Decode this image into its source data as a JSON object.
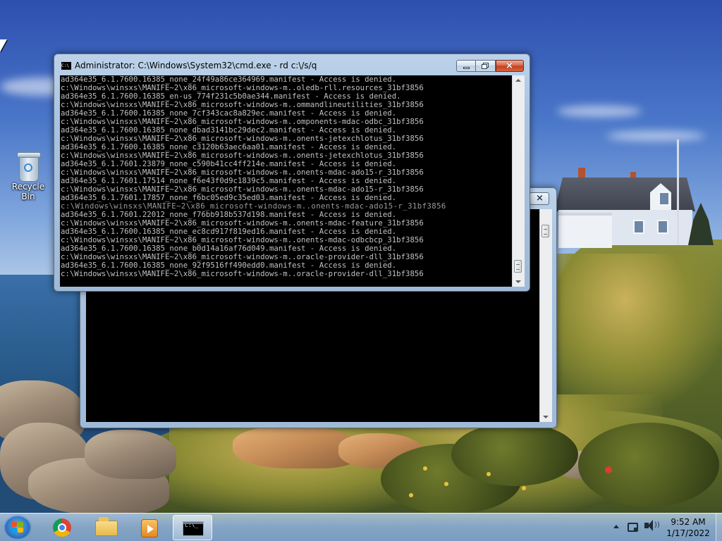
{
  "desktop": {
    "icons": [
      {
        "label": "Recycle Bin",
        "icon": "recycle-bin-icon"
      }
    ]
  },
  "back_window": {
    "close_label": "×"
  },
  "cmd_window": {
    "title": "Administrator: C:\\Windows\\System32\\cmd.exe - rd  c:\\/s/q",
    "icon_text": "C:\\",
    "buttons": {
      "minimize": "minimize",
      "maximize": "restore",
      "close": "close"
    },
    "lines": [
      "ad364e35_6.1.7600.16385_none_24f49a86ce364969.manifest - Access is denied.",
      "c:\\Windows\\winsxs\\MANIFE~2\\x86_microsoft-windows-m..oledb-rll.resources_31bf3856",
      "ad364e35_6.1.7600.16385_en-us_774f231c5b0ae344.manifest - Access is denied.",
      "c:\\Windows\\winsxs\\MANIFE~2\\x86_microsoft-windows-m..ommandlineutilities_31bf3856",
      "ad364e35_6.1.7600.16385_none_7cf343cac8a829ec.manifest - Access is denied.",
      "c:\\Windows\\winsxs\\MANIFE~2\\x86_microsoft-windows-m..omponents-mdac-odbc_31bf3856",
      "ad364e35_6.1.7600.16385_none_dbad3141bc29dec2.manifest - Access is denied.",
      "c:\\Windows\\winsxs\\MANIFE~2\\x86_microsoft-windows-m..onents-jetexchlotus_31bf3856",
      "ad364e35_6.1.7600.16385_none_c3120b63aec6aa01.manifest - Access is denied.",
      "c:\\Windows\\winsxs\\MANIFE~2\\x86_microsoft-windows-m..onents-jetexchlotus_31bf3856",
      "ad364e35_6.1.7601.23879_none_c590b41cc4ff214e.manifest - Access is denied.",
      "c:\\Windows\\winsxs\\MANIFE~2\\x86_microsoft-windows-m..onents-mdac-ado15-r_31bf3856",
      "ad364e35_6.1.7601.17514_none_f6e43f0d9c1839c5.manifest - Access is denied.",
      "c:\\Windows\\winsxs\\MANIFE~2\\x86_microsoft-windows-m..onents-mdac-ado15-r_31bf3856",
      "ad364e35_6.1.7601.17857_none_f6bc05ed9c35ed03.manifest - Access is denied.",
      "c:\\Windows\\winsxs\\MANIFE~2\\x86_microsoft-windows-m..onents-mdac-ado15-r_31bf3856",
      "ad364e35_6.1.7601.22012_none_f76bb918b537d198.manifest - Access is denied.",
      "c:\\Windows\\winsxs\\MANIFE~2\\x86_microsoft-windows-m..onents-mdac-feature_31bf3856",
      "ad364e35_6.1.7600.16385_none_ec8cd917f819ed16.manifest - Access is denied.",
      "c:\\Windows\\winsxs\\MANIFE~2\\x86_microsoft-windows-m..onents-mdac-odbcbcp_31bf3856",
      "ad364e35_6.1.7600.16385_none_b0d14a16af76d049.manifest - Access is denied.",
      "c:\\Windows\\winsxs\\MANIFE~2\\x86_microsoft-windows-m..oracle-provider-dll_31bf3856",
      "ad364e35_6.1.7600.16385_none_92f9516ff490edd0.manifest - Access is denied.",
      "c:\\Windows\\winsxs\\MANIFE~2\\x86_microsoft-windows-m..oracle-provider-dll_31bf3856"
    ]
  },
  "taskbar": {
    "start_icon": "windows-start-icon",
    "pinned": [
      {
        "name": "chrome",
        "icon": "chrome-icon"
      },
      {
        "name": "explorer",
        "icon": "folder-icon"
      },
      {
        "name": "media-player",
        "icon": "media-player-icon"
      },
      {
        "name": "cmd",
        "icon": "cmd-icon",
        "active": true
      }
    ],
    "icon_text_cmd": "C:\\_",
    "clock": {
      "time": "9:52 AM",
      "date": "1/17/2022"
    }
  },
  "colors": {
    "console_bg": "#000000",
    "console_text": "#c0c0c0",
    "close_button": "#c6401f"
  }
}
